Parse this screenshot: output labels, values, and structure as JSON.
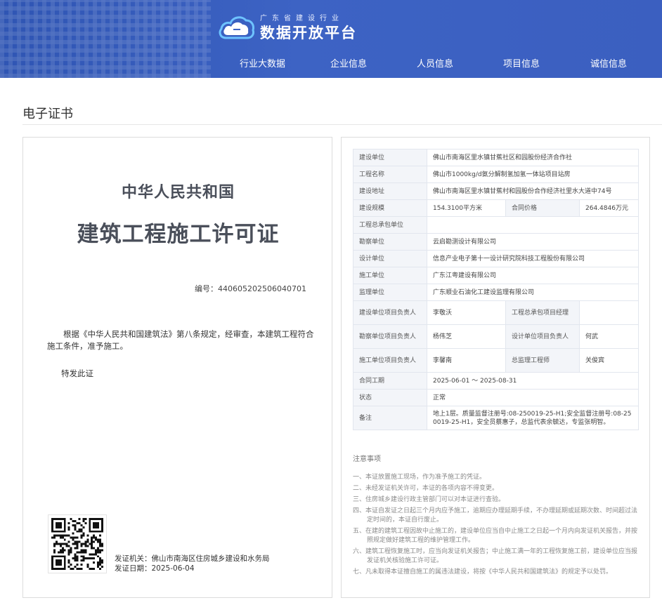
{
  "header": {
    "logo_sub": "广东省建设行业",
    "logo_title": "数据开放平台",
    "nav": [
      "行业大数据",
      "企业信息",
      "人员信息",
      "项目信息",
      "诚信信息"
    ]
  },
  "section_title": "电子证书",
  "certificate": {
    "country": "中华人民共和国",
    "title": "建筑工程施工许可证",
    "number": "编号：440605202506040701",
    "body": "根据《中华人民共和国建筑法》第八条规定，经审查，本建筑工程符合施工条件，准予施工。",
    "special": "特发此证",
    "issuer": "发证机关：佛山市南海区住房城乡建设和水务局",
    "issue_date": "发证日期：2025-06-04"
  },
  "details": {
    "rows": [
      {
        "label": "建设单位",
        "value": "佛山市南海区里水镇甘蕉社区和园股份经济合作社"
      },
      {
        "label": "工程名称",
        "value": "佛山市1000kg/d氨分解制氢加氢一体站项目站房"
      },
      {
        "label": "建设地址",
        "value": "佛山市南海区里水镇甘蕉村和园股份合作经济社里水大道中74号"
      },
      {
        "label": "建设规模",
        "value": "154.3100平方米",
        "label2": "合同价格",
        "value2": "264.4846万元"
      },
      {
        "label": "工程总承包单位",
        "value": ""
      },
      {
        "label": "勘察单位",
        "value": "云启勘测设计有限公司"
      },
      {
        "label": "设计单位",
        "value": "信息产业电子第十一设计研究院科技工程股份有限公司"
      },
      {
        "label": "施工单位",
        "value": "广东江粤建设有限公司"
      },
      {
        "label": "监理单位",
        "value": "广东顺业石油化工建设监理有限公司"
      },
      {
        "label": "建设单位项目负责人",
        "value": "李敬沃",
        "label2": "工程总承包项目经理",
        "value2": ""
      },
      {
        "label": "勘察单位项目负责人",
        "value": "杨伟芝",
        "label2": "设计单位项目负责人",
        "value2": "何武"
      },
      {
        "label": "施工单位项目负责人",
        "value": "李馨南",
        "label2": "总监理工程师",
        "value2": "关俊宾"
      },
      {
        "label": "合同工期",
        "value": "2025-06-01 ～ 2025-08-31"
      },
      {
        "label": "状态",
        "value": "正常"
      },
      {
        "label": "备注",
        "value": "地上1层。质量监督注册号:08-250019-25-H1;安全监督注册号:08-250019-25-H1，安全员蔡惠子，总监代表余毓达，专监张明智。"
      }
    ]
  },
  "notes": {
    "title": "注意事项",
    "items": [
      "一、本证放置施工现场，作为准予施工的凭证。",
      "二、未经发证机关许可，本证的各项内容不得变更。",
      "三、住房城乡建设行政主管部门可以对本证进行查验。",
      "四、本证自发证之日起三个月内应予施工，逾期应办理延期手续，不办理延期或延期次数、时间超过法定时间的，本证自行废止。",
      "五、在建的建筑工程因故中止施工的，建设单位应当自中止施工之日起一个月内向发证机关报告，并按照规定做好建筑工程的维护管理工作。",
      "六、建筑工程恢复施工时，应当向发证机关报告；中止施工满一年的工程恢复施工前，建设单位应当报发证机关核验施工许可证。",
      "七、凡未取得本证擅自施工的属违法建设，将按《中华人民共和国建筑法》的规定予以处罚。"
    ]
  },
  "colors": {
    "header_blue": "#3a5fc0",
    "label_bg": "#f3f5f9",
    "border": "#dcdcdc"
  }
}
